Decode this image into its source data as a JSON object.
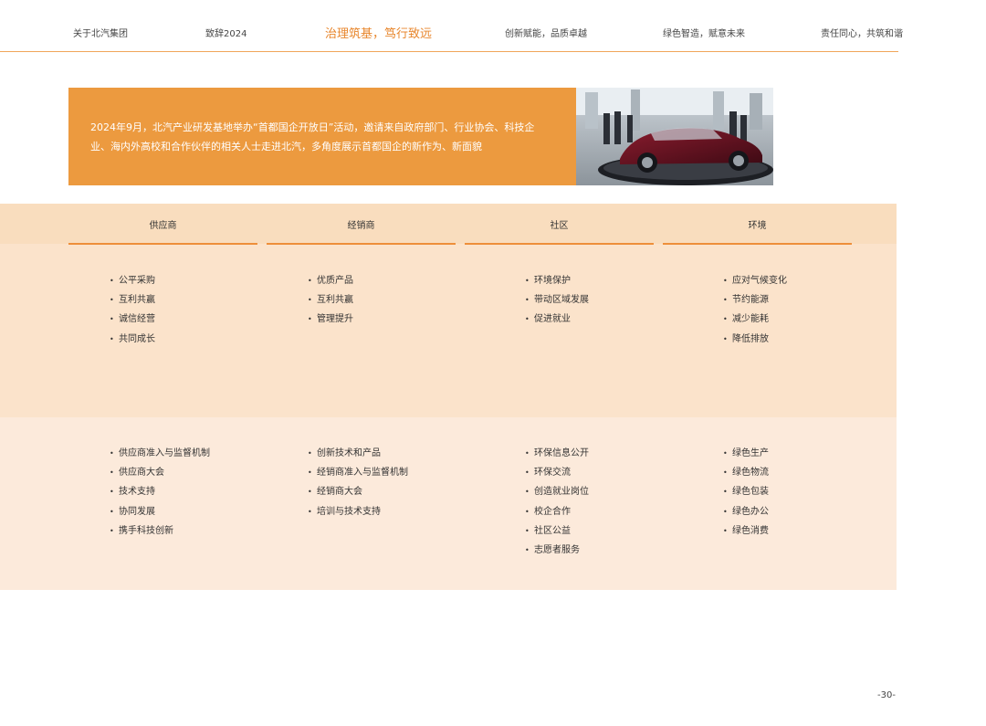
{
  "nav": {
    "items": [
      {
        "label": "关于北汽集团",
        "active": false
      },
      {
        "label": "致辞2024",
        "active": false
      },
      {
        "label": "治理筑基，笃行致远",
        "active": true
      },
      {
        "label": "创新赋能，品质卓越",
        "active": false
      },
      {
        "label": "绿色智造，赋意未来",
        "active": false
      },
      {
        "label": "责任同心，共筑和谐",
        "active": false
      }
    ]
  },
  "banner": {
    "text": "2024年9月，北汽产业研发基地举办“首都国企开放日”活动，邀请来自政府部门、行业协会、科技企业、海内外高校和合作伙伴的相关人士走进北汽，多角度展示首都国企的新作为、新面貌"
  },
  "columns": [
    {
      "header": "供应商",
      "issues": [
        "公平采购",
        "互利共赢",
        "诚信经营",
        "共同成长"
      ],
      "actions": [
        "供应商准入与监督机制",
        "供应商大会",
        "技术支持",
        "协同发展",
        "携手科技创新"
      ]
    },
    {
      "header": "经销商",
      "issues": [
        "优质产品",
        "互利共赢",
        "管理提升"
      ],
      "actions": [
        "创新技术和产品",
        "经销商准入与监督机制",
        "经销商大会",
        "培训与技术支持"
      ]
    },
    {
      "header": "社区",
      "issues": [
        "环境保护",
        "带动区域发展",
        "促进就业"
      ],
      "actions": [
        "环保信息公开",
        "环保交流",
        "创造就业岗位",
        "校企合作",
        "社区公益",
        "志愿者服务"
      ]
    },
    {
      "header": "环境",
      "issues": [
        "应对气候变化",
        "节约能源",
        "减少能耗",
        "降低排放"
      ],
      "actions": [
        "绿色生产",
        "绿色物流",
        "绿色包装",
        "绿色办公",
        "绿色消费"
      ]
    }
  ],
  "page_number": "-30-",
  "colors": {
    "accent": "#EC9A3F",
    "nav_active": "#E8862C",
    "header_band": "#F9DDBE",
    "mid_band": "#FBE3CB",
    "bottom_band": "#FCEADB"
  }
}
